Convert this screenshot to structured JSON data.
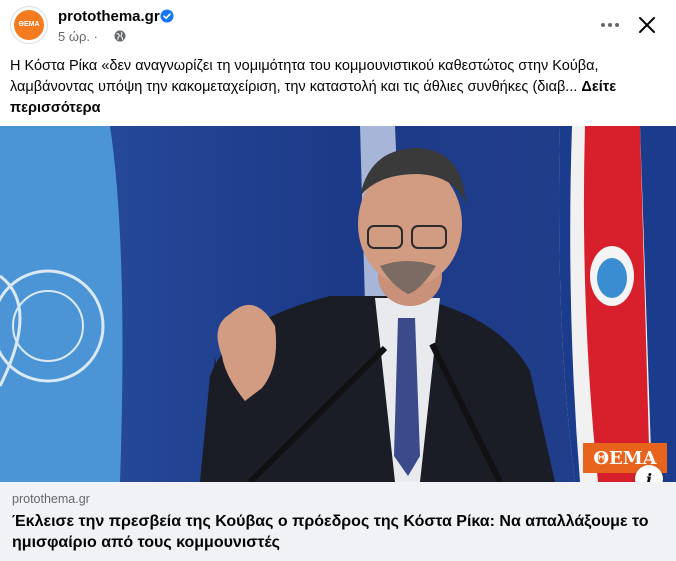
{
  "post": {
    "page_name": "protothema.gr",
    "avatar_label": "ΘΕΜΑ",
    "time": "5 ώρ.",
    "separator": "·",
    "text": "Η Κόστα Ρίκα «δεν αναγνωρίζει τη νομιμότητα του κομμουνιστικού καθεστώτος στην Κούβα, λαμβάνοντας υπόψη την κακομεταχείριση, την καταστολή και τις άθλιες συνθήκες (διαβ...",
    "see_more": "Δείτε περισσότερα",
    "icons": [
      "verified-badge-icon",
      "globe-icon",
      "more-options-icon",
      "close-icon",
      "info-icon"
    ]
  },
  "image": {
    "logo_text": "ΘΕΜΑ",
    "info_label": "i"
  },
  "link": {
    "domain": "protothema.gr",
    "title": "Έκλεισε την πρεσβεία της Κούβας ο πρόεδρος της Κόστα Ρίκα: Να απαλλάξουμε το ημισφαίριο από τους κομμουνιστές"
  },
  "colors": {
    "verified": "#1877f2",
    "secondary_text": "#65676b",
    "link_bg": "#f0f2f5",
    "brand_orange": "#e8641c"
  }
}
